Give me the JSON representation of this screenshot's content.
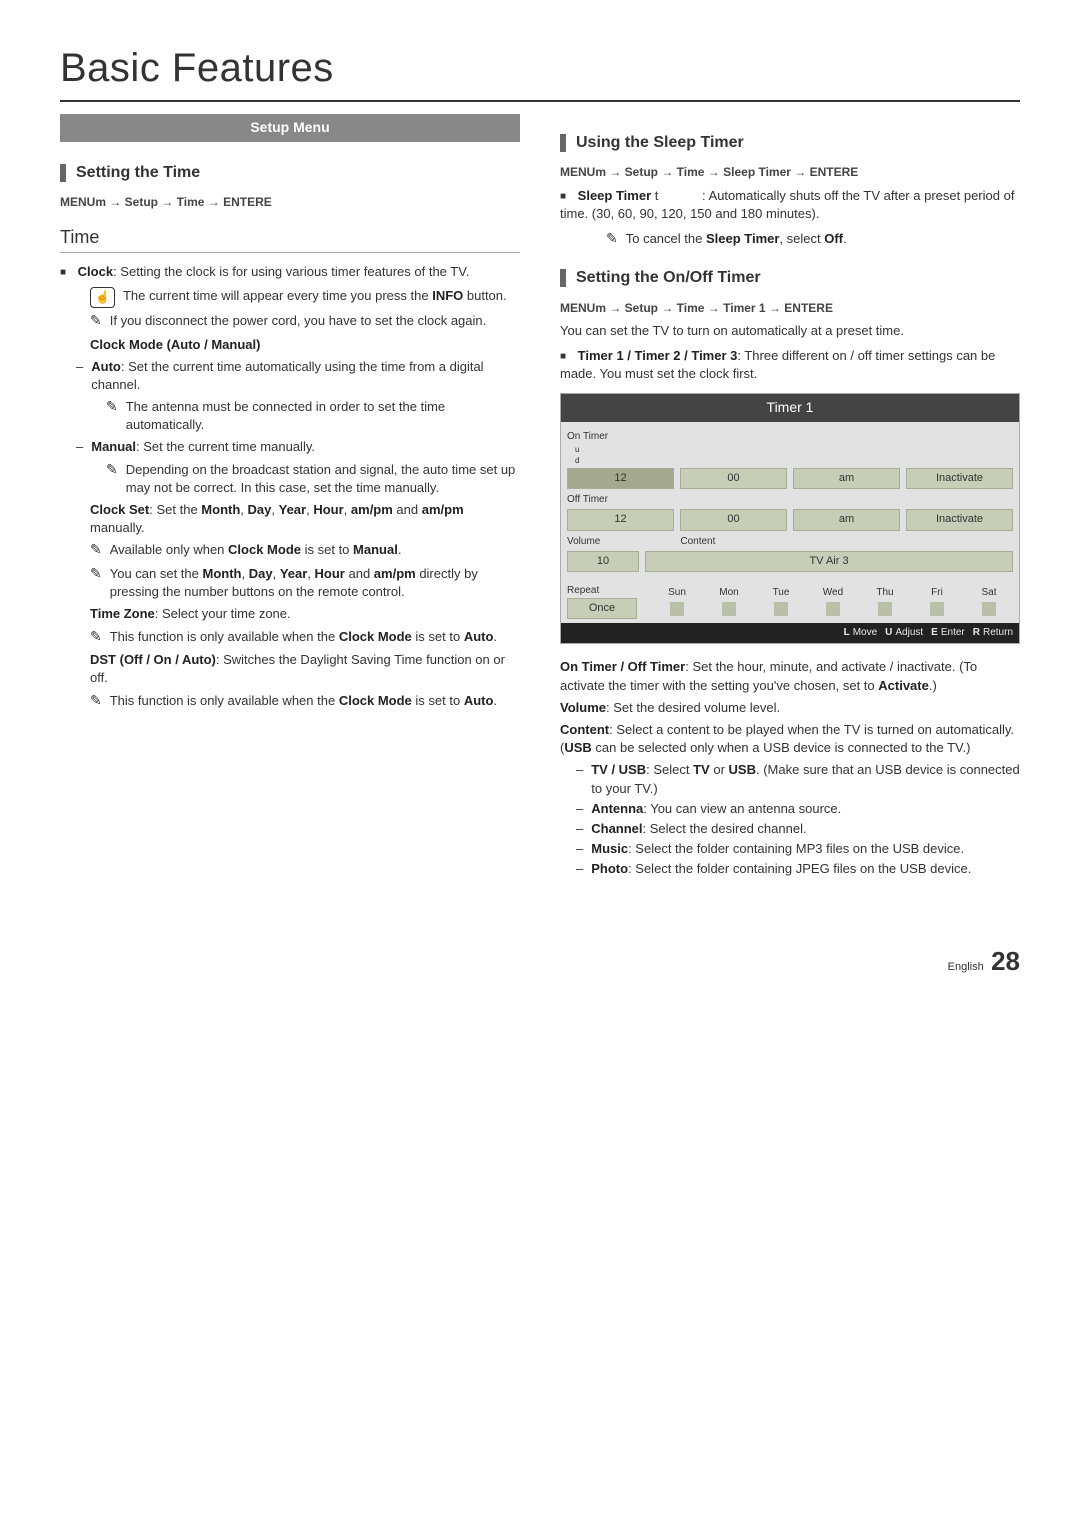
{
  "page": {
    "title": "Basic Features",
    "lang": "English",
    "num": "28"
  },
  "setupMenu": "Setup Menu",
  "left": {
    "sec1": "Setting the Time",
    "path1": "MENUm  → Setup → Time → ENTERE",
    "timeHeading": "Time",
    "clockLead": "Clock",
    "clockText": ": Setting the clock is for using various timer features of the TV.",
    "clockNote1": "The current time will appear every time you press the ",
    "clockNote1b": "INFO",
    "clockNote1c": " button.",
    "clockNote2": "If you disconnect the power cord, you have to set the clock again.",
    "clockMode": "Clock Mode (Auto / Manual)",
    "autoLabel": "Auto",
    "autoText": ": Set the current time automatically using the time from a digital channel.",
    "autoNote": "The antenna must be connected in order to set the time automatically.",
    "manualLabel": "Manual",
    "manualText": ": Set the current time manually.",
    "manualNote": "Depending on the broadcast station and signal, the auto time set up may not be correct. In this case, set the time manually.",
    "clockSetLead": "Clock Set",
    "clockSetText1": ": Set the ",
    "clockSetWords": [
      "Month",
      "Day",
      "Year",
      "Hour",
      "am/pm"
    ],
    "clockSetText2": " and ",
    "clockSetText3": " manually.",
    "csNote1a": "Available only when ",
    "csNote1b": "Clock Mode",
    "csNote1c": " is set to ",
    "csNote1d": "Manual",
    "csNote2a": "You can set the ",
    "csNote2Words": [
      "Month",
      "Day",
      "Year",
      "Hour",
      "am/pm"
    ],
    "csNote2b": " and ",
    "csNote2c": " directly by pressing the number buttons on the remote control.",
    "tzLabel": "Time Zone",
    "tzText": ": Select your time zone.",
    "tzNote1a": "This function is only available when the ",
    "tzNote1b": "Clock Mode",
    "tzNote1c": " is set to ",
    "tzNote1d": "Auto",
    "dstLabel": "DST (Off / On / Auto)",
    "dstText": ": Switches the Daylight Saving Time function on or off.",
    "dstNote1a": "This function is only available when the ",
    "dstNote1b": "Clock Mode",
    "dstNote1c": " is set to ",
    "dstNote1d": "Auto"
  },
  "right": {
    "sec1": "Using the Sleep Timer",
    "path1": "MENUm  → Setup → Time → Sleep Timer → ENTERE",
    "sleepLabel": "Sleep Timer",
    "sleepT": "t",
    "sleepText": ": Automatically shuts off the TV after a preset period of time. (30, 60, 90, 120, 150 and 180 minutes).",
    "sleepNote1a": "To cancel the ",
    "sleepNote1b": "Sleep Timer",
    "sleepNote1c": ", select ",
    "sleepNote1d": "Off",
    "sec2": "Setting the On/Off Timer",
    "path2": "MENUm  → Setup → Time → Timer 1 → ENTERE",
    "intro2": "You can set the TV to turn on automatically at a preset time.",
    "t123Label": "Timer 1 / Timer 2 / Timer 3",
    "t123Text": ": Three different on / off timer settings can be made. You must set the clock first.",
    "panel": {
      "title": "Timer 1",
      "onTimer": "On Timer",
      "offTimer": "Off Timer",
      "rowOn": [
        "12",
        "00",
        "am",
        "Inactivate"
      ],
      "rowOff": [
        "12",
        "00",
        "am",
        "Inactivate"
      ],
      "volume": "Volume",
      "volumeVal": "10",
      "content": "Content",
      "contentVal": "TV  Air  3",
      "repeat": "Repeat",
      "repeatVal": "Once",
      "days": [
        "Sun",
        "Mon",
        "Tue",
        "Wed",
        "Thu",
        "Fri",
        "Sat"
      ],
      "footer": {
        "move": "Move",
        "adjust": "Adjust",
        "enter": "Enter",
        "ret": "Return",
        "kMove": "L",
        "kAdjust": "U",
        "kEnter": "E",
        "kReturn": "R"
      }
    },
    "p1a": "On Timer / Off Timer",
    "p1b": ": Set the hour, minute, and activate / inactivate. (To activate the timer with the setting you've chosen, set to ",
    "p1c": "Activate",
    "p1d": ".)",
    "p2a": "Volume",
    "p2b": ": Set the desired volume level.",
    "p3a": "Content",
    "p3b": ": Select a content to be played when the TV is turned on automatically. (",
    "p3c": "USB",
    "p3d": " can be selected only when a USB device is connected to the TV.)",
    "d1a": "TV / USB",
    "d1b": ": Select ",
    "d1c": "TV",
    "d1d": " or ",
    "d1e": "USB",
    "d1f": ". (Make sure that an USB device is connected to your TV.)",
    "d2a": "Antenna",
    "d2b": ": You can view an antenna source.",
    "d3a": "Channel",
    "d3b": ": Select the desired channel.",
    "d4a": "Music",
    "d4b": ": Select the folder containing MP3 files on the USB device.",
    "d5a": "Photo",
    "d5b": ": Select the folder containing JPEG files on the USB device."
  }
}
